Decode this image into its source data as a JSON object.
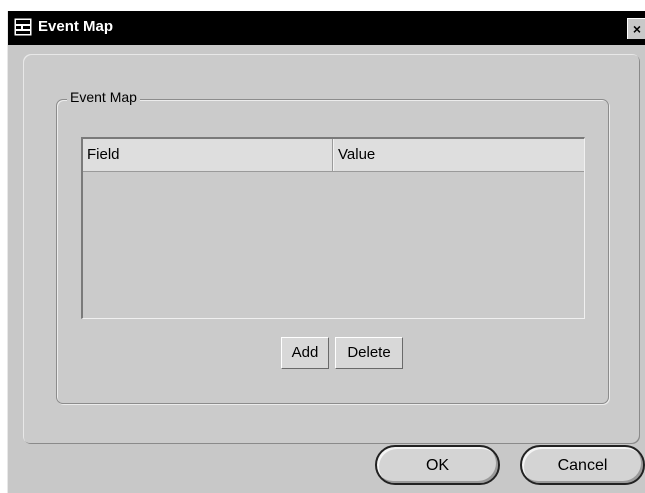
{
  "window": {
    "title": "Event Map",
    "close_glyph": "×",
    "icon": "app-icon"
  },
  "groupbox": {
    "legend": "Event Map"
  },
  "table": {
    "columns": [
      "Field",
      "Value"
    ],
    "rows": []
  },
  "buttons": {
    "add_label": "Add",
    "delete_label": "Delete",
    "ok_label": "OK",
    "cancel_label": "Cancel"
  },
  "colors": {
    "titlebar": "#000000",
    "surface": "#c8c8c8"
  }
}
